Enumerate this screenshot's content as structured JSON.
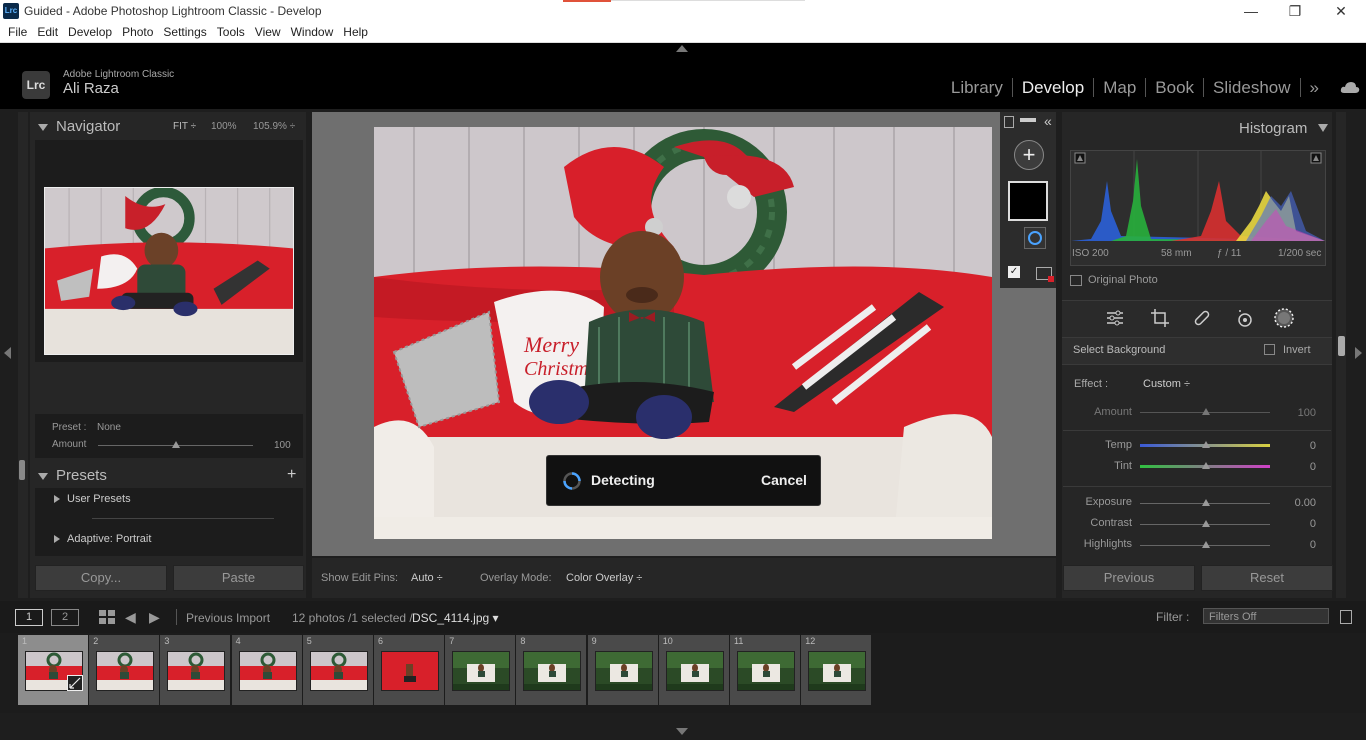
{
  "window": {
    "title": "Guided - Adobe Photoshop Lightroom Classic - Develop",
    "app_icon": "Lrc"
  },
  "menu": [
    "File",
    "Edit",
    "Develop",
    "Photo",
    "Settings",
    "Tools",
    "View",
    "Window",
    "Help"
  ],
  "identity": {
    "badge": "Lrc",
    "product": "Adobe Lightroom Classic",
    "user": "Ali Raza"
  },
  "modules": {
    "items": [
      "Library",
      "Develop",
      "Map",
      "Book",
      "Slideshow"
    ],
    "active": "Develop",
    "more": "»"
  },
  "navigator": {
    "title": "Navigator",
    "fit": "FIT ÷",
    "zoom1": "100%",
    "zoom2": "105.9% ÷"
  },
  "preset_amount": {
    "preset_label": "Preset :",
    "preset_value": "None",
    "amount_label": "Amount",
    "amount_value": "100",
    "amount_fraction": 0.55
  },
  "presets": {
    "title": "Presets",
    "add": "+",
    "items": [
      "User Presets",
      "Adaptive: Portrait"
    ]
  },
  "left_buttons": {
    "copy": "Copy...",
    "paste": "Paste"
  },
  "detecting": {
    "label": "Detecting",
    "cancel": "Cancel"
  },
  "center_toolbar": {
    "pins_label": "Show Edit Pins:",
    "pins_value": "Auto ÷",
    "overlay_label": "Overlay Mode:",
    "overlay_value": "Color Overlay ÷"
  },
  "histogram": {
    "title": "Histogram",
    "iso": "ISO 200",
    "focal": "58 mm",
    "aperture": "ƒ / 11",
    "shutter": "1/200 sec",
    "original_photo": "Original Photo"
  },
  "mask": {
    "title": "Select Background",
    "invert": "Invert",
    "effect_label": "Effect :",
    "effect_value": "Custom ÷"
  },
  "adjustments": [
    {
      "label": "Amount",
      "value": "100",
      "pos": 0.5
    },
    {
      "label": "Temp",
      "value": "0",
      "pos": 0.5
    },
    {
      "label": "Tint",
      "value": "0",
      "pos": 0.5
    },
    {
      "label": "Exposure",
      "value": "0.00",
      "pos": 0.5
    },
    {
      "label": "Contrast",
      "value": "0",
      "pos": 0.5
    },
    {
      "label": "Highlights",
      "value": "0",
      "pos": 0.5
    }
  ],
  "right_buttons": {
    "previous": "Previous",
    "reset": "Reset"
  },
  "filmstrip_bar": {
    "screen1": "1",
    "screen2": "2",
    "source": "Previous Import",
    "count": "12 photos /1 selected /",
    "filename": "DSC_4114.jpg ▾",
    "filter_label": "Filter :",
    "filter_value": "Filters Off"
  },
  "filmstrip": [
    "1",
    "2",
    "3",
    "4",
    "5",
    "6",
    "7",
    "8",
    "9",
    "10",
    "11",
    "12"
  ],
  "colors": {
    "accent": "#e0523a",
    "sofa_red": "#d8202a",
    "bg": "#1e1e1e"
  }
}
